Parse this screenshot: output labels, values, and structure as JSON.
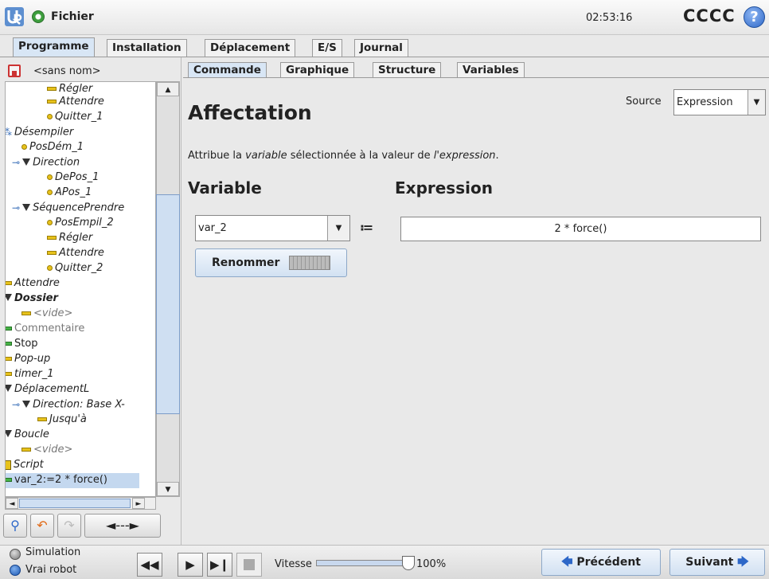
{
  "titlebar": {
    "file_label": "Fichier",
    "clock": "02:53:16",
    "robot_name": "CCCC",
    "help": "?"
  },
  "main_tabs": [
    {
      "label": "Programme",
      "active": true
    },
    {
      "label": "Installation",
      "active": false
    },
    {
      "label": "Déplacement",
      "active": false
    },
    {
      "label": "E/S",
      "active": false
    },
    {
      "label": "Journal",
      "active": false
    }
  ],
  "program": {
    "name": "<sans nom>"
  },
  "tree": [
    {
      "label": "Régler",
      "icon": "bar",
      "style": "italic"
    },
    {
      "label": "Attendre",
      "icon": "bar",
      "style": "italic"
    },
    {
      "label": "Quitter_1",
      "icon": "dot",
      "style": "italic"
    },
    {
      "label": "Désempiler",
      "icon": "branch",
      "style": "italic"
    },
    {
      "label": "PosDém_1",
      "icon": "dot",
      "style": "italic"
    },
    {
      "label": "Direction",
      "icon": "triangle",
      "style": "italic"
    },
    {
      "label": "DePos_1",
      "icon": "dot",
      "style": "italic"
    },
    {
      "label": "APos_1",
      "icon": "dot",
      "style": "italic"
    },
    {
      "label": "SéquencePrendre",
      "icon": "triangle",
      "style": "italic"
    },
    {
      "label": "PosEmpil_2",
      "icon": "dot",
      "style": "italic"
    },
    {
      "label": "Régler",
      "icon": "bar",
      "style": "italic"
    },
    {
      "label": "Attendre",
      "icon": "bar",
      "style": "italic"
    },
    {
      "label": "Quitter_2",
      "icon": "dot",
      "style": "italic"
    },
    {
      "label": "Attendre",
      "icon": "bar",
      "style": "italic"
    },
    {
      "label": "Dossier",
      "icon": "triangle",
      "style": "bold-italic"
    },
    {
      "label": "<vide>",
      "icon": "bar",
      "style": "grey-italic"
    },
    {
      "label": "Commentaire",
      "icon": "green",
      "style": "grey"
    },
    {
      "label": "Stop",
      "icon": "green",
      "style": "normal"
    },
    {
      "label": "Pop-up",
      "icon": "bar",
      "style": "italic"
    },
    {
      "label": "timer_1",
      "icon": "bar",
      "style": "italic"
    },
    {
      "label": "DéplacementL",
      "icon": "triangle",
      "style": "italic"
    },
    {
      "label": "Direction: Base X-",
      "icon": "triangle",
      "style": "italic"
    },
    {
      "label": "Jusqu'à",
      "icon": "bar",
      "style": "italic"
    },
    {
      "label": "Boucle",
      "icon": "triangle",
      "style": "italic"
    },
    {
      "label": "<vide>",
      "icon": "bar",
      "style": "grey-italic"
    },
    {
      "label": "Script",
      "icon": "script",
      "style": "italic"
    },
    {
      "label": "var_2:=2 * force()",
      "icon": "green",
      "style": "selected"
    }
  ],
  "tree_toolbar": {
    "move_label": "◄---►"
  },
  "sub_tabs": [
    {
      "label": "Commande",
      "active": true
    },
    {
      "label": "Graphique",
      "active": false
    },
    {
      "label": "Structure",
      "active": false
    },
    {
      "label": "Variables",
      "active": false
    }
  ],
  "command": {
    "title": "Affectation",
    "source_label": "Source",
    "source_value": "Expression",
    "description_prefix": "Attribue la ",
    "description_var": "variable",
    "description_mid": " sélectionnée à la valeur de ",
    "description_expr": "l'expression",
    "description_suffix": ".",
    "variable_heading": "Variable",
    "expression_heading": "Expression",
    "variable_value": "var_2",
    "assign_op": "≔",
    "expression_value": "2 * force()",
    "rename_label": "Renommer"
  },
  "bottom": {
    "simulation_label": "Simulation",
    "real_robot_label": "Vrai robot",
    "speed_label": "Vitesse",
    "speed_value": "100%",
    "speed_fraction": 1.0,
    "prev_label": "Précédent",
    "next_label": "Suivant"
  },
  "colors": {
    "accent": "#d8e6f5",
    "selected_bg": "#c4d8ef",
    "node_yellow": "#e7c21b",
    "node_green": "#47b347",
    "help_blue": "#2d67c8"
  }
}
